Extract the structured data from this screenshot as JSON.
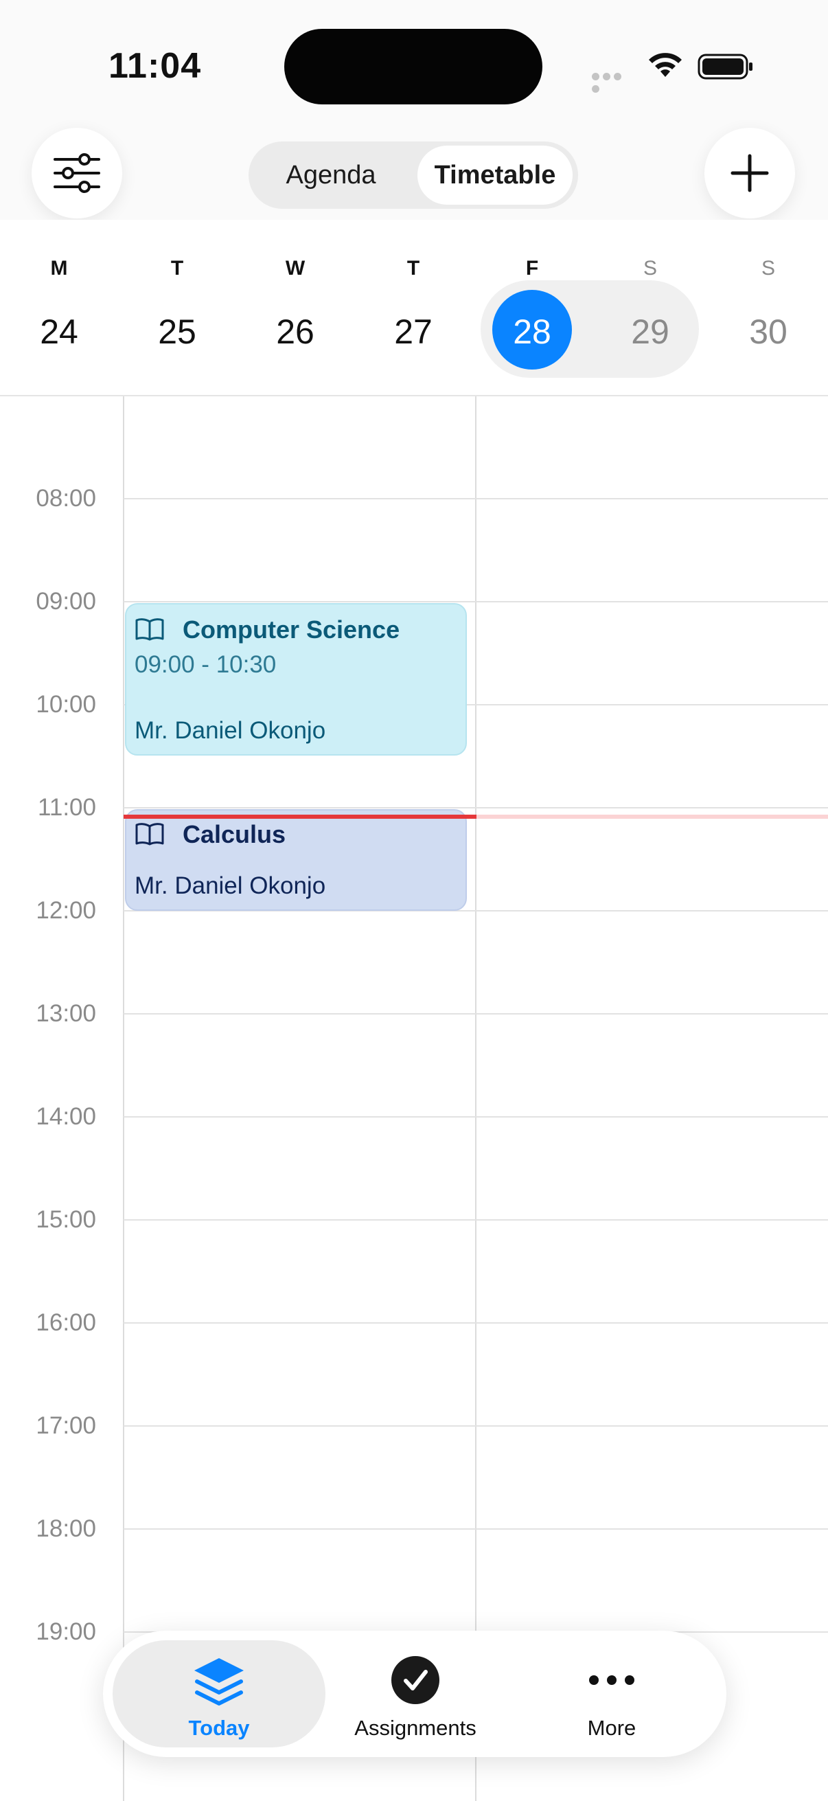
{
  "status_bar": {
    "time": "11:04"
  },
  "header": {
    "segments": [
      {
        "label": "Agenda",
        "active": false
      },
      {
        "label": "Timetable",
        "active": true
      }
    ],
    "filter_icon": "sliders-icon",
    "add_icon": "plus-icon"
  },
  "week": {
    "days": [
      {
        "letter": "M",
        "number": "24"
      },
      {
        "letter": "T",
        "number": "25"
      },
      {
        "letter": "W",
        "number": "26"
      },
      {
        "letter": "T",
        "number": "27"
      },
      {
        "letter": "F",
        "number": "28"
      },
      {
        "letter": "S",
        "number": "29"
      },
      {
        "letter": "S",
        "number": "30"
      }
    ],
    "selected_day": "28",
    "accent": "#0a84ff"
  },
  "timeline": {
    "hours": [
      "08:00",
      "09:00",
      "10:00",
      "11:00",
      "12:00",
      "13:00",
      "14:00",
      "15:00",
      "16:00",
      "17:00",
      "18:00",
      "19:00"
    ],
    "current_time_color": "#e5383b"
  },
  "events": [
    {
      "title": "Computer Science",
      "time": "09:00 - 10:30",
      "teacher": "Mr. Daniel Okonjo",
      "icon": "book-icon",
      "color": "#cdeff7",
      "text_color": "#0b5a78"
    },
    {
      "title": "Calculus",
      "teacher": "Mr. Daniel Okonjo",
      "icon": "book-icon",
      "color": "#d0dcf2",
      "text_color": "#0f2557"
    }
  ],
  "tabbar": {
    "tabs": [
      {
        "label": "Today",
        "icon": "stack-icon",
        "active": true
      },
      {
        "label": "Assignments",
        "icon": "checkmark-circle-icon",
        "active": false
      },
      {
        "label": "More",
        "icon": "more-dots-icon",
        "active": false
      }
    ]
  }
}
